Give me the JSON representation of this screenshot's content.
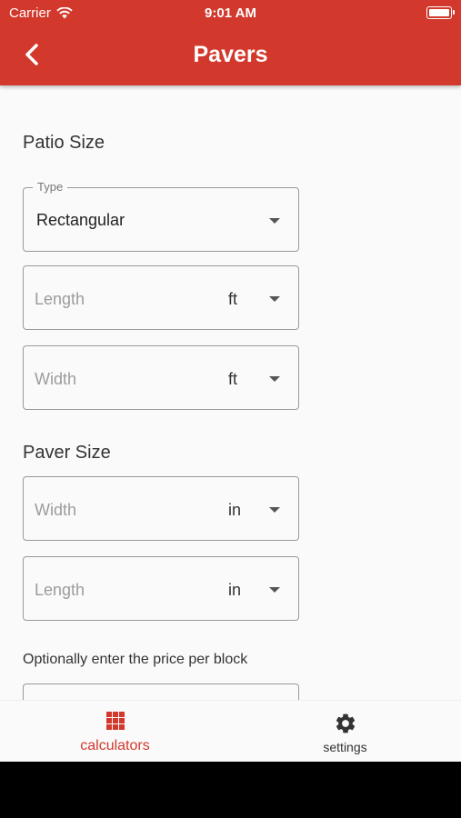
{
  "status_bar": {
    "carrier": "Carrier",
    "time": "9:01 AM"
  },
  "header": {
    "title": "Pavers",
    "back_icon": "chevron-left-icon"
  },
  "patio_section": {
    "title": "Patio Size",
    "type_field": {
      "label": "Type",
      "value": "Rectangular"
    },
    "length_field": {
      "placeholder": "Length",
      "unit": "ft"
    },
    "width_field": {
      "placeholder": "Width",
      "unit": "ft"
    }
  },
  "paver_section": {
    "title": "Paver Size",
    "width_field": {
      "placeholder": "Width",
      "unit": "in"
    },
    "length_field": {
      "placeholder": "Length",
      "unit": "in"
    }
  },
  "price_hint": "Optionally enter the price per block",
  "bottom_nav": {
    "items": [
      {
        "label": "calculators",
        "icon": "grid-icon",
        "active": true
      },
      {
        "label": "settings",
        "icon": "gear-icon",
        "active": false
      }
    ]
  },
  "colors": {
    "primary": "#d2382b",
    "background": "#fafafa"
  }
}
